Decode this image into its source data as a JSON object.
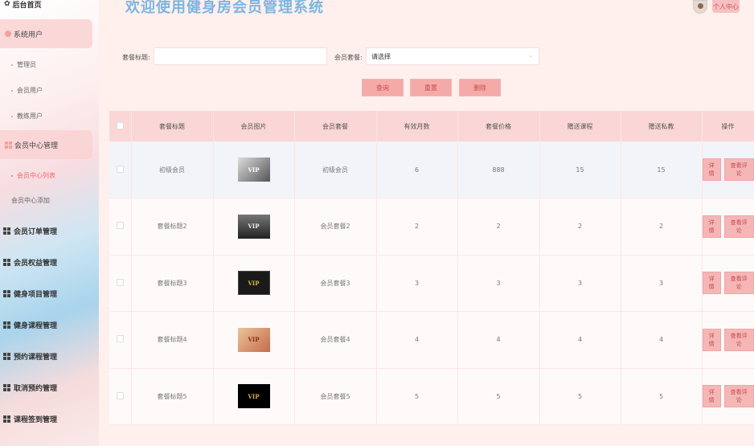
{
  "header": {
    "title": "欢迎使用健身房会员管理系统",
    "profile_label": "个人中心"
  },
  "sidebar": {
    "home": "后台首页",
    "groups": [
      {
        "label": "系统用户",
        "subitems": [
          "管理员",
          "会员用户",
          "教练用户"
        ]
      },
      {
        "label": "会员中心管理",
        "subitems": [
          "会员中心列表",
          "会员中心添加"
        ]
      }
    ],
    "items": [
      "会员订单管理",
      "会员权益管理",
      "健身项目管理",
      "健身课程管理",
      "预约课程管理",
      "取消预约管理",
      "课程签到管理"
    ]
  },
  "search": {
    "title_label": "套餐标题:",
    "title_value": "",
    "package_label": "会员套餐:",
    "package_value": "请选择",
    "query_label": "查询",
    "reset_label": "重置",
    "delete_label": "删除"
  },
  "table": {
    "columns": [
      "套餐标题",
      "会员图片",
      "会员套餐",
      "有效月数",
      "套餐价格",
      "赠送课程",
      "赠送私教",
      "操作"
    ],
    "detail_label": "详情",
    "review_label": "查看评论",
    "rows": [
      {
        "title": "初级会员",
        "img": "VIP",
        "package": "初级会员",
        "months": "6",
        "price": "888",
        "courses": "15",
        "coaching": "15"
      },
      {
        "title": "套餐标题2",
        "img": "VIP",
        "package": "会员套餐2",
        "months": "2",
        "price": "2",
        "courses": "2",
        "coaching": "2"
      },
      {
        "title": "套餐标题3",
        "img": "VIP",
        "package": "会员套餐3",
        "months": "3",
        "price": "3",
        "courses": "3",
        "coaching": "3"
      },
      {
        "title": "套餐标题4",
        "img": "VIP",
        "package": "会员套餐4",
        "months": "4",
        "price": "4",
        "courses": "4",
        "coaching": "4"
      },
      {
        "title": "套餐标题5",
        "img": "VIP",
        "package": "会员套餐5",
        "months": "5",
        "price": "5",
        "courses": "5",
        "coaching": "5"
      }
    ]
  }
}
